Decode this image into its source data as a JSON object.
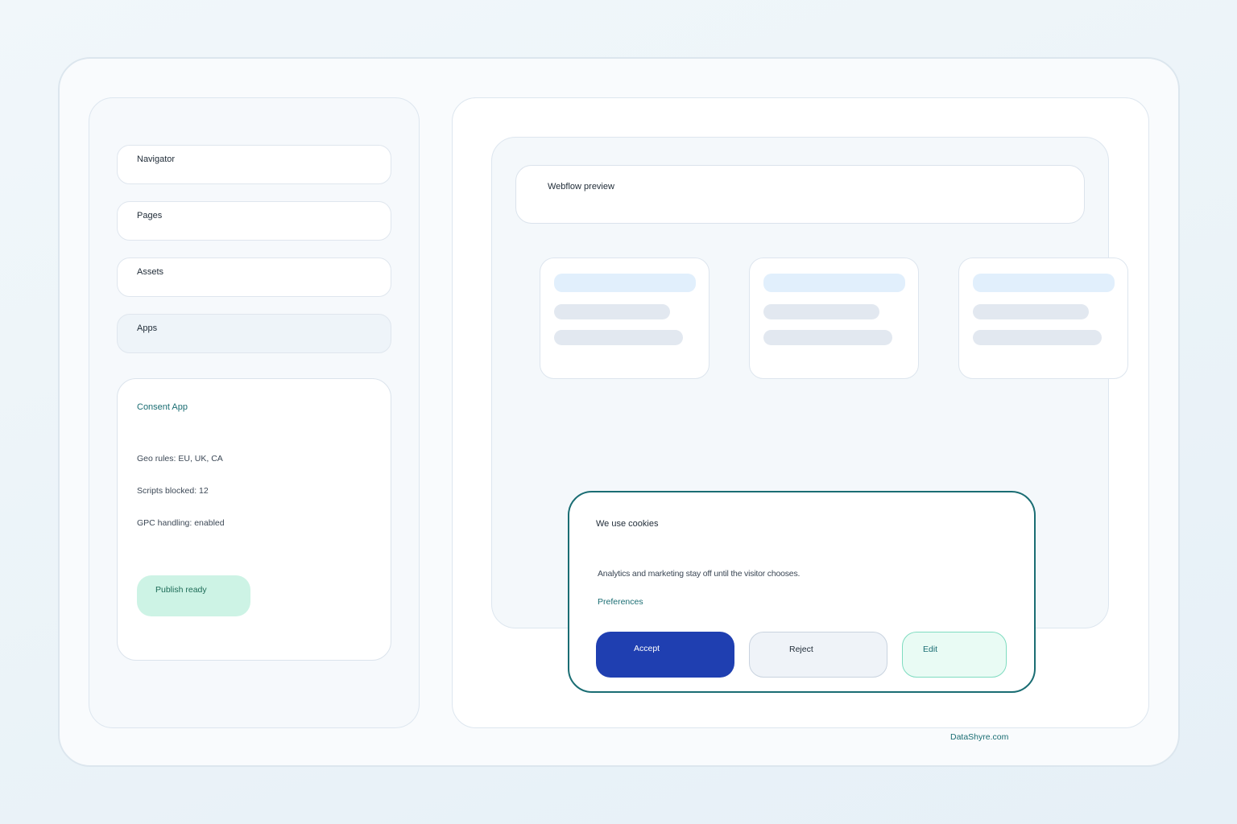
{
  "sidebar": {
    "items": [
      {
        "label": "Navigator"
      },
      {
        "label": "Pages"
      },
      {
        "label": "Assets"
      },
      {
        "label": "Apps"
      }
    ],
    "consent_card": {
      "title": "Consent App",
      "lines": [
        "Geo rules: EU, UK, CA",
        "Scripts blocked: 12",
        "GPC handling: enabled"
      ],
      "status": "Publish ready"
    }
  },
  "main": {
    "preview_label": "Webflow preview"
  },
  "cookie_banner": {
    "title": "We use cookies",
    "description": "Analytics and marketing stay off until the visitor chooses.",
    "preferences_link": "Preferences",
    "buttons": {
      "accept": "Accept",
      "reject": "Reject",
      "edit": "Edit"
    }
  },
  "footer": {
    "link": "DataShyre.com"
  },
  "colors": {
    "accent": "#1a6d73",
    "accept_button": "#1f3fb1",
    "publish_badge": "#cdf3e5"
  }
}
